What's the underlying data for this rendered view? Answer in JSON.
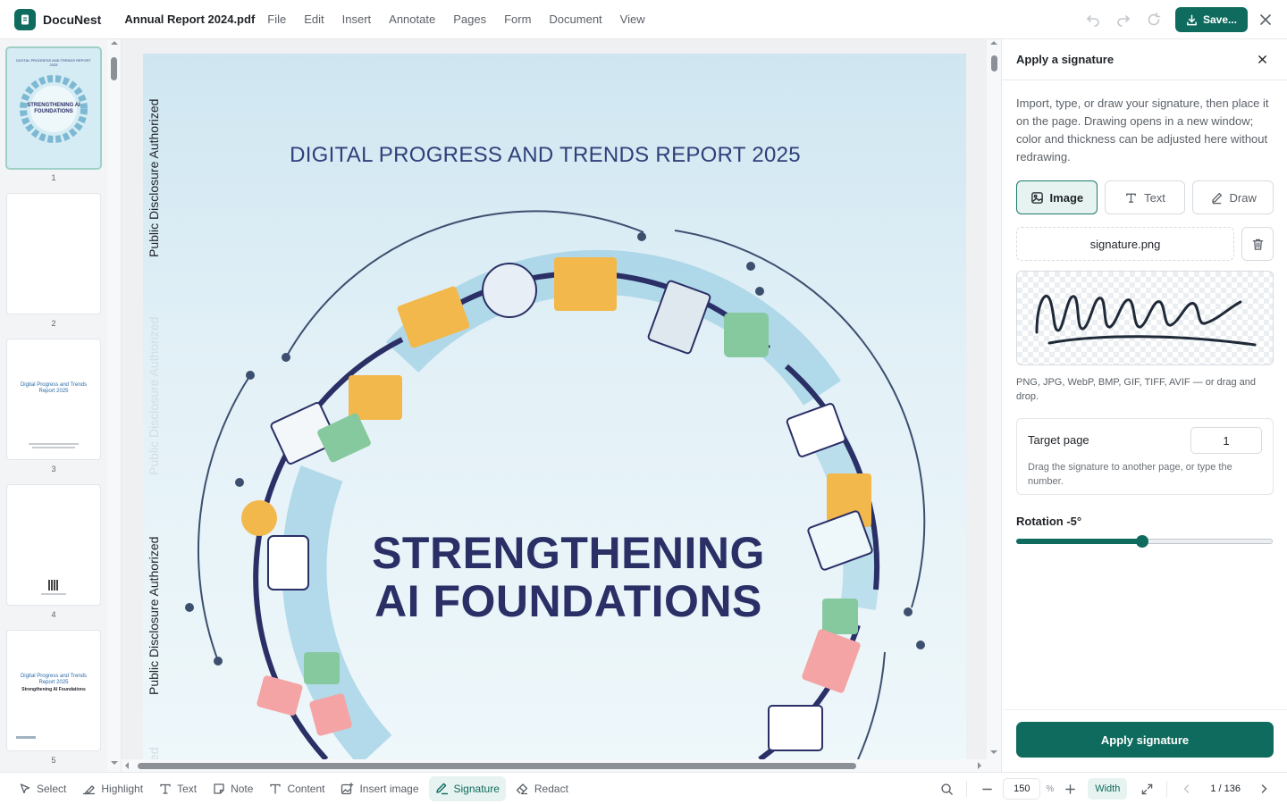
{
  "app": {
    "brand": "DocuNest",
    "document_title": "Annual Report 2024.pdf"
  },
  "menu": [
    "File",
    "Edit",
    "Insert",
    "Annotate",
    "Pages",
    "Form",
    "Document",
    "View"
  ],
  "toolbar": {
    "save_label": "Save..."
  },
  "thumbnails": {
    "pages": [
      {
        "number": "1",
        "active": true,
        "text_top": "DIGITAL PROGRESS AND TRENDS REPORT 2025",
        "text_center": "STRENGTHENING AI FOUNDATIONS"
      },
      {
        "number": "2",
        "active": false
      },
      {
        "number": "3",
        "active": false,
        "text_center": "Digital Progress and Trends Report 2025"
      },
      {
        "number": "4",
        "active": false
      },
      {
        "number": "5",
        "active": false,
        "text_center": "Digital Progress and Trends Report 2025",
        "text_sub": "Strengthening AI Foundations"
      }
    ]
  },
  "document": {
    "watermark": "Public Disclosure Authorized",
    "watermark_partial": "ed",
    "report_title": "DIGITAL PROGRESS AND TRENDS REPORT 2025",
    "cover_title_line1": "STRENGTHENING",
    "cover_title_line2": "AI FOUNDATIONS"
  },
  "signature_panel": {
    "title": "Apply a signature",
    "description": "Import, type, or draw your signature, then place it on the page. Drawing opens in a new window; color and thickness can be adjusted here without redrawing.",
    "modes": [
      {
        "label": "Image",
        "icon": "image-icon",
        "active": true
      },
      {
        "label": "Text",
        "icon": "text-icon",
        "active": false
      },
      {
        "label": "Draw",
        "icon": "pen-icon",
        "active": false
      }
    ],
    "file_name": "signature.png",
    "formats_hint": "PNG, JPG, WebP, BMP, GIF, TIFF, AVIF — or drag and drop.",
    "target_page_label": "Target page",
    "target_page_value": "1",
    "target_page_hint": "Drag the signature to another page, or type the number.",
    "rotation_label": "Rotation -5°",
    "rotation_level": 0.49,
    "apply_label": "Apply signature"
  },
  "bottom_tools": [
    {
      "label": "Select",
      "icon": "cursor-icon",
      "active": false
    },
    {
      "label": "Highlight",
      "icon": "highlighter-icon",
      "active": false
    },
    {
      "label": "Text",
      "icon": "text-icon",
      "active": false
    },
    {
      "label": "Note",
      "icon": "note-icon",
      "active": false
    },
    {
      "label": "Content",
      "icon": "content-icon",
      "active": false
    },
    {
      "label": "Insert image",
      "icon": "insert-image-icon",
      "active": false
    },
    {
      "label": "Signature",
      "icon": "signature-icon",
      "active": true
    },
    {
      "label": "Redact",
      "icon": "eraser-icon",
      "active": false
    }
  ],
  "view": {
    "zoom_value": "150",
    "zoom_unit": "%",
    "fit_label": "Width",
    "page_indicator": "1 / 136"
  },
  "colors": {
    "accent": "#0f6b5e",
    "accent_light": "#e6f3f1",
    "title_blue": "#2f3f7a",
    "cover_navy": "#2a2f66"
  }
}
